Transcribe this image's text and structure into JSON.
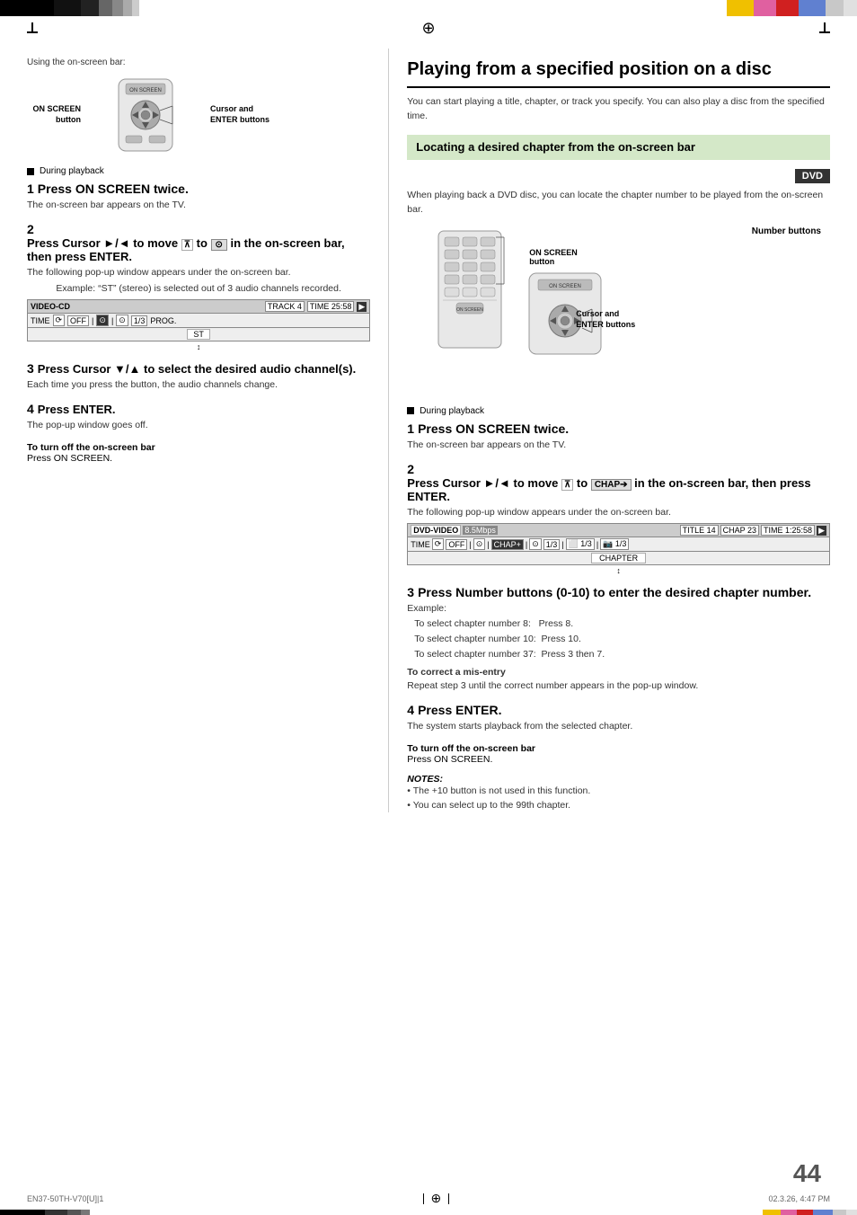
{
  "page": {
    "number": "44",
    "footer_left": "EN37-50TH-V70[U]|1",
    "footer_center": "44",
    "footer_right": "02.3.26, 4:47 PM"
  },
  "top_bars_left": [
    "black",
    "black",
    "black",
    "gray",
    "gray",
    "gray",
    "lgray"
  ],
  "top_bars_right": [
    "yellow",
    "pink",
    "red",
    "blue",
    "lt1",
    "lt2"
  ],
  "left_column": {
    "section_label": "Using the on-screen bar:",
    "on_screen_label": "ON SCREEN\nbutton",
    "cursor_label": "Cursor and\nENTER buttons",
    "playback_note": "During playback",
    "step1": {
      "number": "1",
      "title": "Press ON SCREEN twice.",
      "body": "The on-screen bar appears on the TV."
    },
    "step2": {
      "number": "2",
      "title": "Press Cursor ►/◄ to move",
      "title2": "to",
      "title3": "in the on-screen bar, then press ENTER.",
      "body": "The following pop-up window appears under the on-screen bar.",
      "example_label": "Example:",
      "example_text": "“ST” (stereo) is selected out of 3 audio channels recorded.",
      "screen_bar_row1": "VIDEO-CD",
      "screen_bar_track": "TRACK 4",
      "screen_bar_time": "TIME  25:58",
      "screen_bar_row2_time": "TIME",
      "screen_bar_row2_off": "OFF",
      "screen_bar_row2_cd": "1/3",
      "screen_bar_row2_prog": "PROG.",
      "screen_bar_st": "ST"
    },
    "step3": {
      "number": "3",
      "title": "Press Cursor ▼/▲ to select the desired audio channel(s).",
      "body": "Each time you press the button, the audio channels change."
    },
    "step4": {
      "number": "4",
      "title": "Press ENTER.",
      "body": "The pop-up window goes off."
    },
    "turn_off": {
      "label": "To turn off the on-screen bar",
      "text": "Press ON SCREEN."
    }
  },
  "right_column": {
    "title": "Playing from a specified position on a disc",
    "intro": "You can start playing a title, chapter, or track you specify. You can also play a disc from the specified time.",
    "sub_section_title": "Locating a desired chapter from the on-screen bar",
    "dvd_badge": "DVD",
    "playback_intro": "When playing back a DVD disc, you can locate the chapter number to be played from the on-screen bar.",
    "number_buttons_label": "Number buttons",
    "on_screen_label": "ON SCREEN\nbutton",
    "cursor_label": "Cursor and\nENTER buttons",
    "playback_note": "During playback",
    "step1": {
      "number": "1",
      "title": "Press ON SCREEN twice.",
      "body": "The on-screen bar appears on the TV."
    },
    "step2": {
      "number": "2",
      "title": "Press Cursor ►/◄ to move",
      "title2": "to",
      "title3": "in the on-screen bar, then press ENTER.",
      "body": "The following pop-up window appears under the on-screen bar.",
      "screen_dvd": "DVD-VIDEO",
      "screen_mbps": "8.5Mbps",
      "screen_title": "TITLE 14",
      "screen_chap": "CHAP 23",
      "screen_time": "TIME 1:25:58",
      "screen_row2_time": "TIME",
      "screen_row2_off": "OFF",
      "screen_row2_chap1": "CHAP.+",
      "screen_row2_cd": "1/3",
      "screen_row2_num": "1/3",
      "screen_row2_cam": "1/3",
      "screen_chapter": "CHAPTER"
    },
    "step3": {
      "number": "3",
      "title": "Press Number buttons (0-10) to enter the desired chapter number.",
      "example_label": "Example:",
      "example_lines": [
        "To select chapter number 8:   Press 8.",
        "To select chapter number 10:  Press 10.",
        "To select chapter number 37:  Press 3 then 7."
      ],
      "correct_label": "To correct a mis-entry",
      "correct_text": "Repeat step 3 until the correct number appears in the pop-up window."
    },
    "step4": {
      "number": "4",
      "title": "Press ENTER.",
      "body": "The system starts playback from the selected chapter."
    },
    "turn_off": {
      "label": "To turn off the on-screen bar",
      "text": "Press ON SCREEN."
    },
    "notes": {
      "title": "NOTES:",
      "items": [
        "The +10 button is not used in this function.",
        "You can select up to the 99th chapter."
      ]
    }
  }
}
